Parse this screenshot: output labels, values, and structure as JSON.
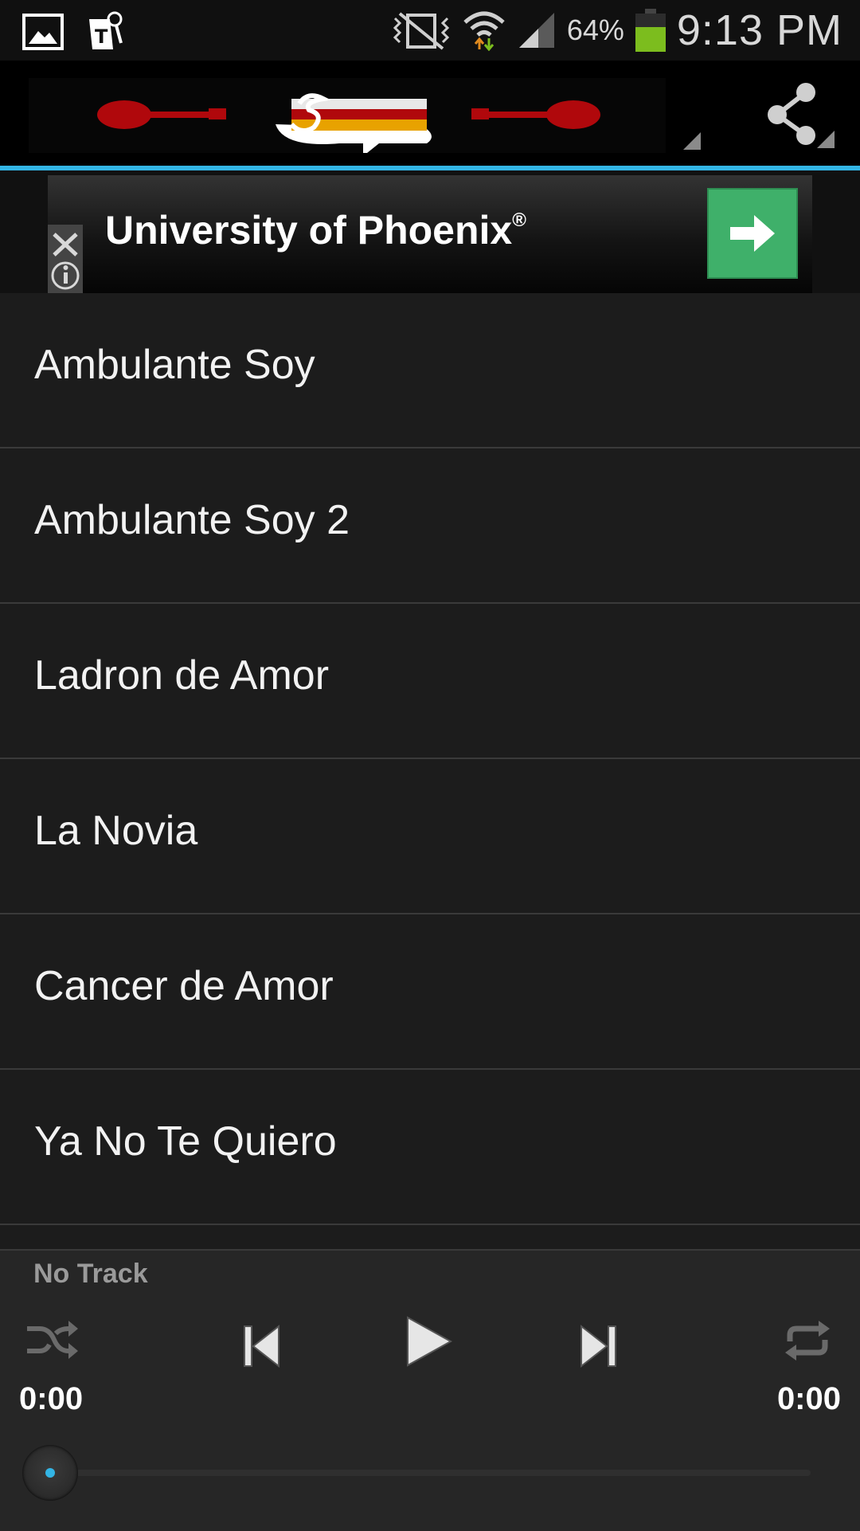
{
  "status_bar": {
    "battery_percent": "64%",
    "time": "9:13 PM",
    "icons": [
      "gallery-notification-icon",
      "tmobile-notification-icon",
      "vibrate-off-icon",
      "wifi-icon",
      "signal-icon",
      "battery-icon"
    ],
    "battery_color": "#7cbd1e"
  },
  "action_bar": {
    "banner_name": "Los Shapis logo banner",
    "share_icon": "share-icon",
    "accent_color": "#33b5e5"
  },
  "ad": {
    "title": "University of Phoenix",
    "registered_mark": "®",
    "button_color": "#3fb06a"
  },
  "songs": [
    {
      "title": "Ambulante Soy"
    },
    {
      "title": "Ambulante Soy 2"
    },
    {
      "title": "Ladron de Amor"
    },
    {
      "title": "La Novia"
    },
    {
      "title": "Cancer de Amor"
    },
    {
      "title": "Ya No Te Quiero"
    }
  ],
  "player": {
    "track_label": "No Track",
    "elapsed": "0:00",
    "duration": "0:00",
    "progress": 0
  }
}
